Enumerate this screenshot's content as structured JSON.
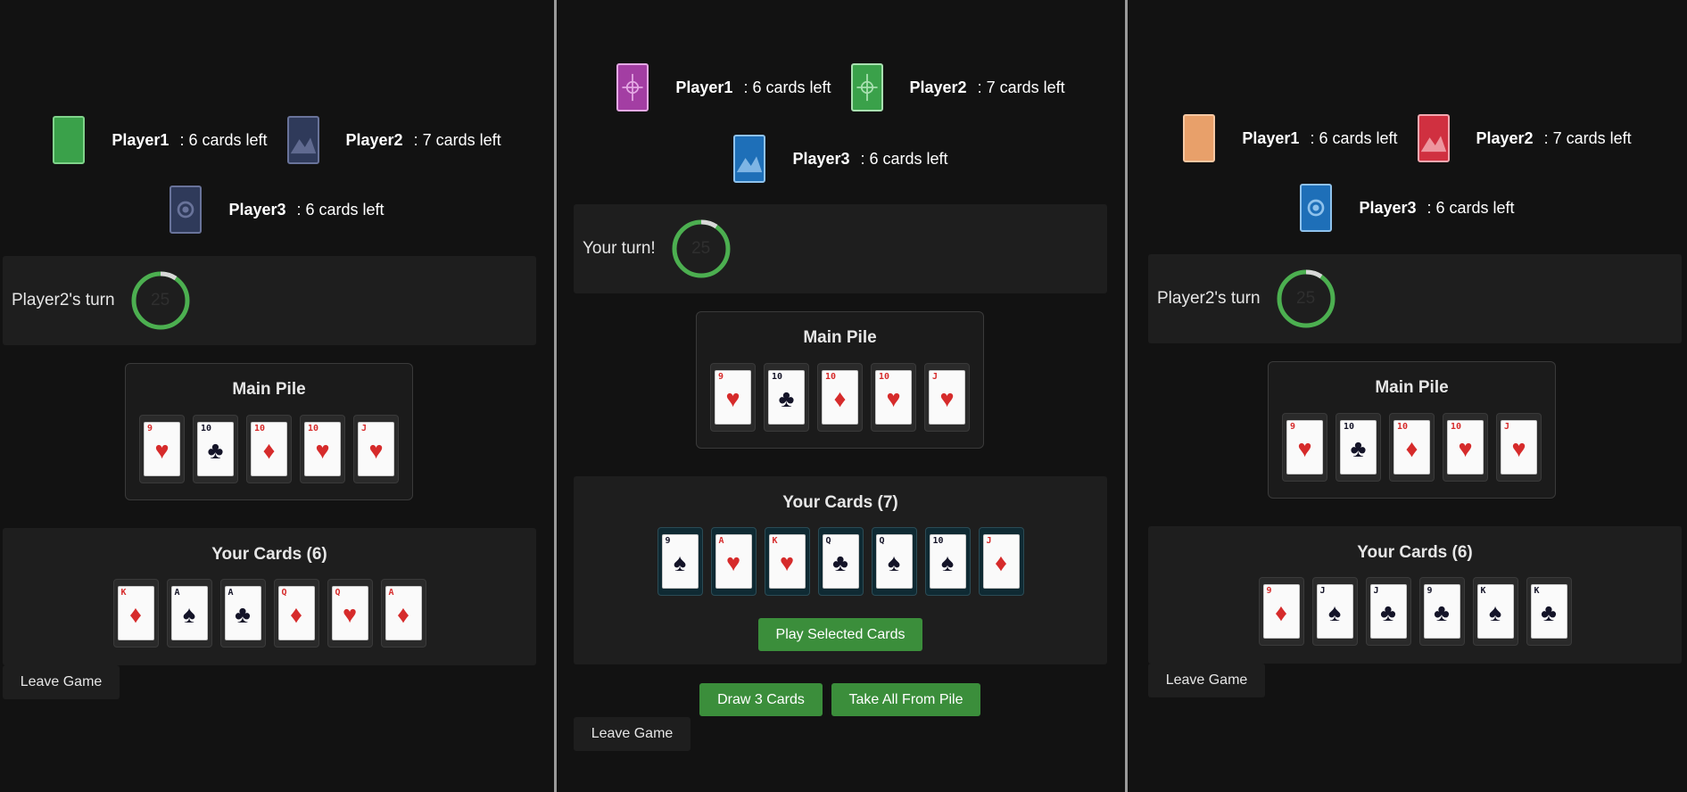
{
  "panels": [
    {
      "players": [
        {
          "name": "Player1",
          "count": ": 6 cards left",
          "back": "green-plain"
        },
        {
          "name": "Player2",
          "count": ": 7 cards left",
          "back": "slate-mountain"
        },
        {
          "name": "Player3",
          "count": ": 6 cards left",
          "back": "slate-emblem"
        }
      ],
      "turn_text": "Player2's turn",
      "timer_value": "25",
      "main_pile": {
        "title": "Main Pile",
        "cards": [
          {
            "rank": "9",
            "suit": "♥",
            "color": "red"
          },
          {
            "rank": "10",
            "suit": "♣",
            "color": "black"
          },
          {
            "rank": "10",
            "suit": "♦",
            "color": "red"
          },
          {
            "rank": "10",
            "suit": "♥",
            "color": "red"
          },
          {
            "rank": "J",
            "suit": "♥",
            "color": "red"
          }
        ]
      },
      "hand": {
        "title": "Your Cards (6)",
        "cards": [
          {
            "rank": "K",
            "suit": "♦",
            "color": "red"
          },
          {
            "rank": "A",
            "suit": "♠",
            "color": "black"
          },
          {
            "rank": "A",
            "suit": "♣",
            "color": "black"
          },
          {
            "rank": "Q",
            "suit": "♦",
            "color": "red"
          },
          {
            "rank": "Q",
            "suit": "♥",
            "color": "red"
          },
          {
            "rank": "A",
            "suit": "♦",
            "color": "red"
          }
        ]
      },
      "leave_label": "Leave Game"
    },
    {
      "players": [
        {
          "name": "Player1",
          "count": ": 6 cards left",
          "back": "purple-compass"
        },
        {
          "name": "Player2",
          "count": ": 7 cards left",
          "back": "green-compass"
        },
        {
          "name": "Player3",
          "count": ": 6 cards left",
          "back": "blue-mountain"
        }
      ],
      "turn_text": "Your turn!",
      "timer_value": "25",
      "main_pile": {
        "title": "Main Pile",
        "cards": [
          {
            "rank": "9",
            "suit": "♥",
            "color": "red"
          },
          {
            "rank": "10",
            "suit": "♣",
            "color": "black"
          },
          {
            "rank": "10",
            "suit": "♦",
            "color": "red"
          },
          {
            "rank": "10",
            "suit": "♥",
            "color": "red"
          },
          {
            "rank": "J",
            "suit": "♥",
            "color": "red"
          }
        ]
      },
      "hand": {
        "title": "Your Cards (7)",
        "cards": [
          {
            "rank": "9",
            "suit": "♠",
            "color": "black"
          },
          {
            "rank": "A",
            "suit": "♥",
            "color": "red"
          },
          {
            "rank": "K",
            "suit": "♥",
            "color": "red"
          },
          {
            "rank": "Q",
            "suit": "♣",
            "color": "black"
          },
          {
            "rank": "Q",
            "suit": "♠",
            "color": "black"
          },
          {
            "rank": "10",
            "suit": "♠",
            "color": "black"
          },
          {
            "rank": "J",
            "suit": "♦",
            "color": "red"
          }
        ]
      },
      "play_label": "Play Selected Cards",
      "draw_label": "Draw 3 Cards",
      "take_label": "Take All From Pile",
      "leave_label": "Leave Game"
    },
    {
      "players": [
        {
          "name": "Player1",
          "count": ": 6 cards left",
          "back": "orange-plain"
        },
        {
          "name": "Player2",
          "count": ": 7 cards left",
          "back": "red-mountain"
        },
        {
          "name": "Player3",
          "count": ": 6 cards left",
          "back": "blue-emblem"
        }
      ],
      "turn_text": "Player2's turn",
      "timer_value": "25",
      "main_pile": {
        "title": "Main Pile",
        "cards": [
          {
            "rank": "9",
            "suit": "♥",
            "color": "red"
          },
          {
            "rank": "10",
            "suit": "♣",
            "color": "black"
          },
          {
            "rank": "10",
            "suit": "♦",
            "color": "red"
          },
          {
            "rank": "10",
            "suit": "♥",
            "color": "red"
          },
          {
            "rank": "J",
            "suit": "♥",
            "color": "red"
          }
        ]
      },
      "hand": {
        "title": "Your Cards (6)",
        "cards": [
          {
            "rank": "9",
            "suit": "♦",
            "color": "red"
          },
          {
            "rank": "J",
            "suit": "♠",
            "color": "black"
          },
          {
            "rank": "J",
            "suit": "♣",
            "color": "black"
          },
          {
            "rank": "9",
            "suit": "♣",
            "color": "black"
          },
          {
            "rank": "K",
            "suit": "♠",
            "color": "black"
          },
          {
            "rank": "K",
            "suit": "♣",
            "color": "black"
          }
        ]
      },
      "leave_label": "Leave Game"
    }
  ],
  "colors": {
    "background": "#121212",
    "box": "#1e1e1e",
    "accent_green": "#3b8e3b",
    "timer_ring": "#4caf50"
  },
  "card_backs": {
    "green-plain": {
      "fill": "#3aa14a",
      "border": "#7fd38a",
      "art": "none"
    },
    "slate-mountain": {
      "fill": "#2f3a5a",
      "border": "#69739a",
      "art": "mountain"
    },
    "slate-emblem": {
      "fill": "#2f3a5a",
      "border": "#69739a",
      "art": "emblem"
    },
    "purple-compass": {
      "fill": "#a33ea3",
      "border": "#e4a8e4",
      "art": "compass"
    },
    "green-compass": {
      "fill": "#3aa14a",
      "border": "#a8e0b0",
      "art": "compass"
    },
    "blue-mountain": {
      "fill": "#1e6fb8",
      "border": "#8fc2ec",
      "art": "mountain"
    },
    "orange-plain": {
      "fill": "#e8a06a",
      "border": "#f5c8a3",
      "art": "none"
    },
    "red-mountain": {
      "fill": "#d03040",
      "border": "#f2a8b0",
      "art": "mountain"
    },
    "blue-emblem": {
      "fill": "#1e6fb8",
      "border": "#8fc2ec",
      "art": "emblem"
    }
  }
}
